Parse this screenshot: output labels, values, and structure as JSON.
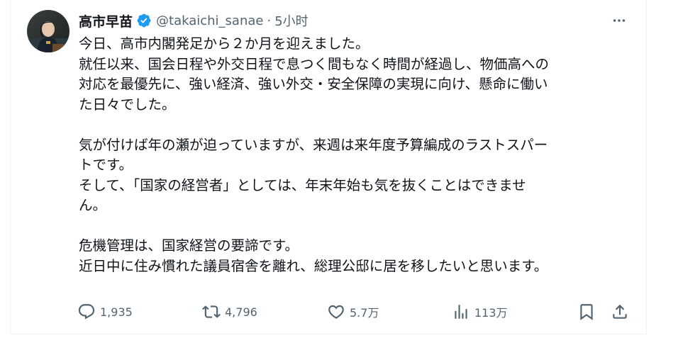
{
  "tweet": {
    "author_name": "高市早苗",
    "handle": "@takaichi_sanae",
    "separator": "·",
    "time": "5小时",
    "verified_icon": "verified-badge-icon",
    "lines": [
      "今日、高市内閣発足から２か月を迎えました。",
      "就任以来、国会日程や外交日程で息つく間もなく時間が経過し、物価高への",
      "対応を最優先に、強い経済、強い外交・安全保障の実現に向け、懸命に働い",
      "た日々でした。",
      "",
      "気が付けば年の瀬が迫っていますが、来週は来年度予算編成のラストスパー",
      "トです。",
      "そして、「国家の経営者」としては、年末年始も気を抜くことはできませ",
      "ん。",
      "",
      "危機管理は、国家経営の要諦です。",
      "近日中に住み慣れた議員宿舎を離れ、総理公邸に居を移したいと思います。"
    ]
  },
  "actions": {
    "reply_count": "1,935",
    "retweet_count": "4,796",
    "like_count": "5.7万",
    "views_count": "113万"
  },
  "colors": {
    "text": "#0f1419",
    "secondary": "#536471",
    "verified": "#1d9bf0",
    "border": "#eff3f4"
  }
}
